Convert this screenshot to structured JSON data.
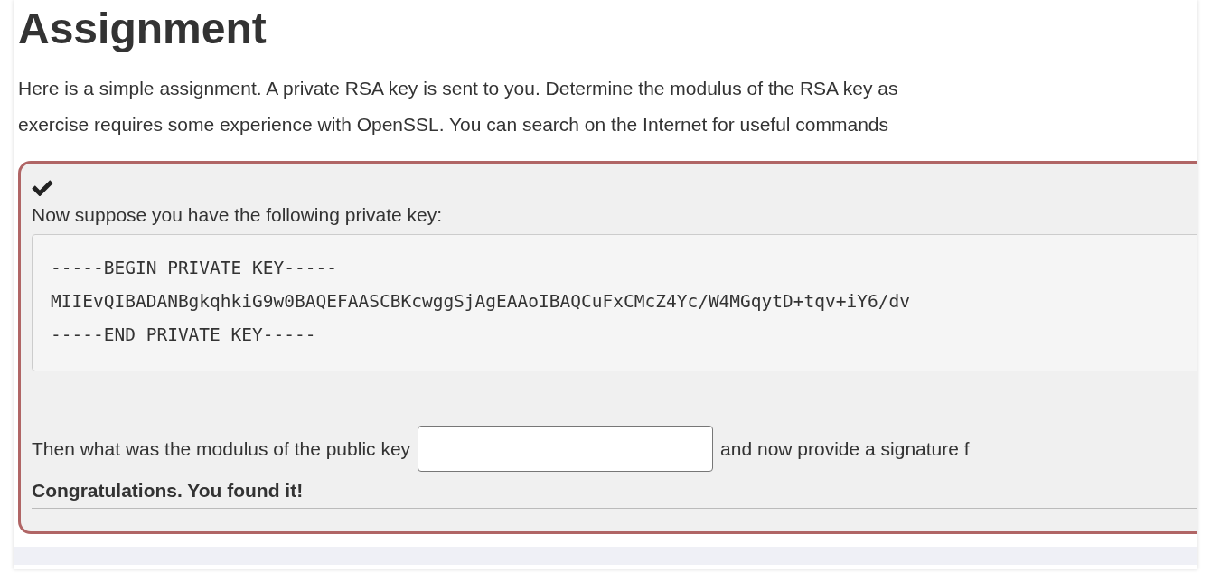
{
  "heading": "Assignment",
  "intro": [
    "Here is a simple assignment. A private RSA key is sent to you. Determine the modulus of the RSA key as",
    "exercise requires some experience with OpenSSL. You can search on the Internet for useful commands"
  ],
  "question": {
    "answered": true,
    "prompt": "Now suppose you have the following private key:",
    "key_lines": [
      "-----BEGIN PRIVATE KEY-----",
      "MIIEvQIBADANBgkqhkiG9w0BAQEFAASCBKcwggSjAgEAAoIBAQCuFxCMcZ4Yc/W4MGqytD+tqv+iY6/dv",
      "-----END PRIVATE KEY-----"
    ],
    "before_field": "Then what was the modulus of the public key",
    "after_field": "and now provide a signature f",
    "feedback": "Congratulations. You found it!"
  }
}
